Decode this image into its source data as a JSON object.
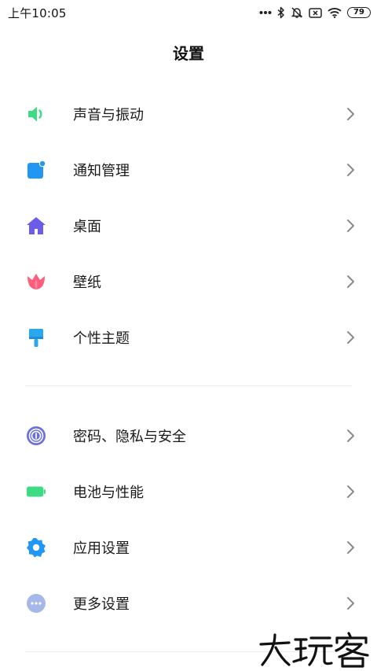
{
  "status_bar": {
    "time": "上午10:05",
    "battery_level": "79",
    "icons": [
      "more-dots-icon",
      "bluetooth-icon",
      "alarm-off-icon",
      "sim-error-icon",
      "wifi-icon",
      "battery-icon"
    ]
  },
  "page": {
    "title": "设置"
  },
  "groups": [
    {
      "items": [
        {
          "label": "声音与振动",
          "icon": "speaker-icon",
          "color": "#3ddc84"
        },
        {
          "label": "通知管理",
          "icon": "notification-icon",
          "color": "#2196f3"
        },
        {
          "label": "桌面",
          "icon": "home-icon",
          "color": "#6c5ce7"
        },
        {
          "label": "壁纸",
          "icon": "tulip-icon",
          "color": "#ff5f7e"
        },
        {
          "label": "个性主题",
          "icon": "paintbrush-icon",
          "color": "#29a8f0"
        }
      ]
    },
    {
      "items": [
        {
          "label": "密码、隐私与安全",
          "icon": "fingerprint-icon",
          "color": "#6a6fe0"
        },
        {
          "label": "电池与性能",
          "icon": "battery-green-icon",
          "color": "#3ddc84"
        },
        {
          "label": "应用设置",
          "icon": "gear-icon",
          "color": "#2196f3"
        },
        {
          "label": "更多设置",
          "icon": "more-icon",
          "color": "#a5b8e8"
        }
      ]
    }
  ],
  "watermark": {
    "text": "大玩客"
  }
}
